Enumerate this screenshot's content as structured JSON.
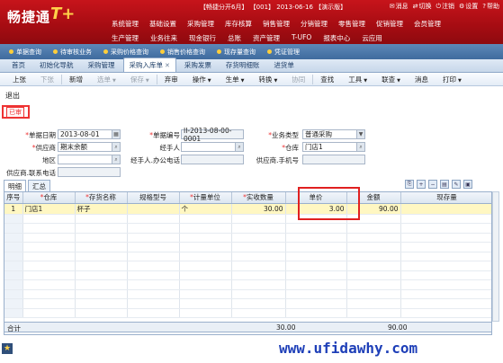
{
  "header": {
    "logo_text": "畅捷通",
    "logo_suffix": "T+",
    "status": "【畅捷分开6月】 【001】 2013-06-16 【演示版】",
    "tools": [
      "消息",
      "切换",
      "注销",
      "设置",
      "帮助"
    ],
    "menu_row1": [
      "系统管理",
      "基础设置",
      "采购管理",
      "库存核算",
      "销售管理",
      "分销管理",
      "零售管理",
      "促销管理",
      "会员管理"
    ],
    "menu_row2": [
      "生产管理",
      "业务往来",
      "现金银行",
      "总账",
      "资产管理",
      "T-UFO",
      "报表中心",
      "云应用"
    ]
  },
  "subnav": [
    "单据查询",
    "待审核业务",
    "采购价格查询",
    "销售价格查询",
    "现存量查询",
    "凭证管理"
  ],
  "tabs": [
    {
      "label": "首页"
    },
    {
      "label": "初始化导航"
    },
    {
      "label": "采购管理"
    },
    {
      "label": "采购入库单",
      "active": true
    },
    {
      "label": "采购发票"
    },
    {
      "label": "存货明细账"
    },
    {
      "label": "进货单"
    }
  ],
  "toolbar": [
    "上张",
    "下张",
    "新增",
    "选单",
    "保存",
    "弃审",
    "操作",
    "生单",
    "转换",
    "协同",
    "查找",
    "工具",
    "联查",
    "消息",
    "打印"
  ],
  "exit_label": "退出",
  "audit_stamp": "已审",
  "form": {
    "date_label": "单据日期",
    "date_value": "2013-08-01",
    "no_label": "单据编号",
    "no_value": "II-2013-08-00-0001",
    "type_label": "业务类型",
    "type_value": "普通采购",
    "supplier_label": "供应商",
    "supplier_value": "期末余额",
    "handler_label": "经手人",
    "handler_value": "",
    "warehouse_label": "仓库",
    "warehouse_value": "门店1",
    "region_label": "地区",
    "region_value": "",
    "handler_phone_label": "经手人.办公电话",
    "handler_phone_value": "",
    "supplier_mobile_label": "供应商.手机号",
    "supplier_mobile_value": "",
    "supplier_tel_label": "供应商.联系电话",
    "supplier_tel_value": ""
  },
  "grid_tabs": [
    "明细",
    "汇总"
  ],
  "grid": {
    "headers": [
      "序号",
      "仓库",
      "存货名称",
      "规格型号",
      "计量单位",
      "实收数量",
      "单价",
      "金额",
      "现存量"
    ],
    "rows": [
      [
        "1",
        "门店1",
        "杯子",
        "",
        "个",
        "30.00",
        "3.00",
        "90.00",
        ""
      ]
    ],
    "empty_rows": 11
  },
  "totals": {
    "label": "合计",
    "qty": "30.00",
    "amount": "90.00"
  },
  "watermark": "www.ufidawhy.com"
}
